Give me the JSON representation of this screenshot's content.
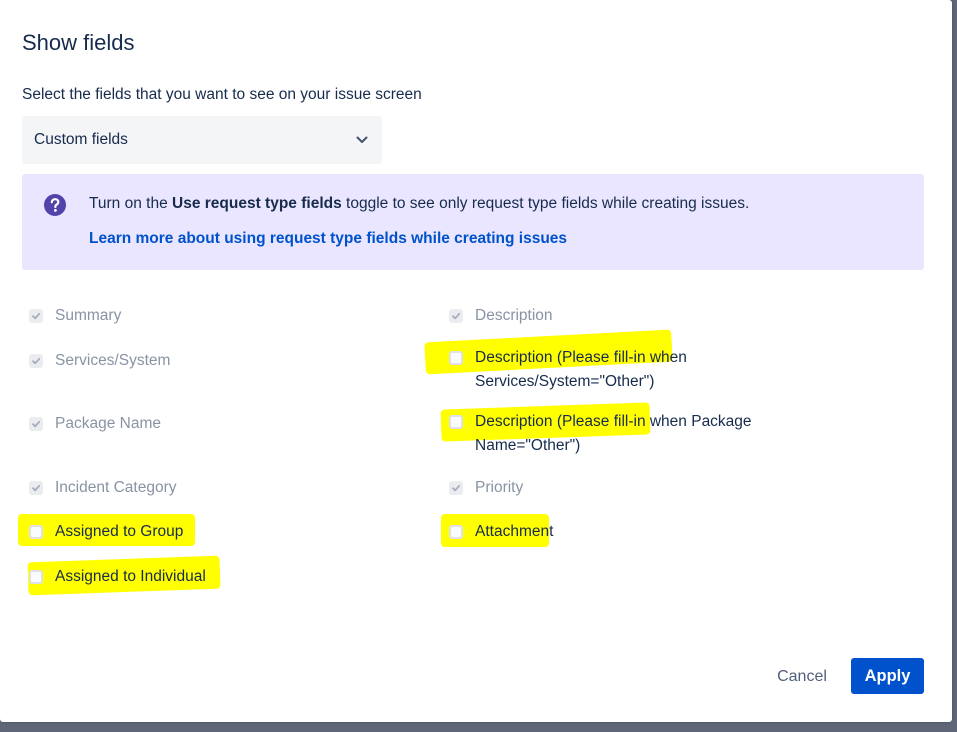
{
  "dialog": {
    "title": "Show fields",
    "subtitle": "Select the fields that you want to see on your issue screen"
  },
  "select": {
    "value": "Custom fields",
    "icon": "chevron-down-icon"
  },
  "info": {
    "icon": "question-circle-icon",
    "text_before": "Turn on the ",
    "text_bold": "Use request type fields",
    "text_after": " toggle to see only request type fields while creating issues.",
    "link": "Learn more about using request type fields while creating issues",
    "background": "#eae6ff",
    "icon_color": "#5243aa"
  },
  "fields": {
    "summary": {
      "label": "Summary",
      "checked": true,
      "disabled": true
    },
    "description": {
      "label": "Description",
      "checked": true,
      "disabled": true
    },
    "services_system": {
      "label": "Services/System",
      "checked": true,
      "disabled": true
    },
    "desc_services": {
      "line1": "Description (Please fill-in when",
      "line2": "Services/System=\"Other\")",
      "checked": false,
      "highlighted": true
    },
    "package_name": {
      "label": "Package Name",
      "checked": true,
      "disabled": true
    },
    "desc_package": {
      "line1": "Description (Please fill-in when Package",
      "line2": "Name=\"Other\")",
      "checked": false,
      "highlighted": true
    },
    "incident_category": {
      "label": "Incident Category",
      "checked": true,
      "disabled": true
    },
    "priority": {
      "label": "Priority",
      "checked": true,
      "disabled": true
    },
    "assigned_group": {
      "label": "Assigned to Group",
      "checked": false,
      "highlighted": true
    },
    "attachment": {
      "label": "Attachment",
      "checked": false,
      "highlighted": true
    },
    "assigned_individual": {
      "label": "Assigned to Individual",
      "checked": false,
      "highlighted": true
    }
  },
  "footer": {
    "cancel_label": "Cancel",
    "apply_label": "Apply"
  },
  "colors": {
    "primary": "#0052cc",
    "text": "#172b4d",
    "disabled_text": "#8993a4",
    "highlight": "#ffff00"
  }
}
